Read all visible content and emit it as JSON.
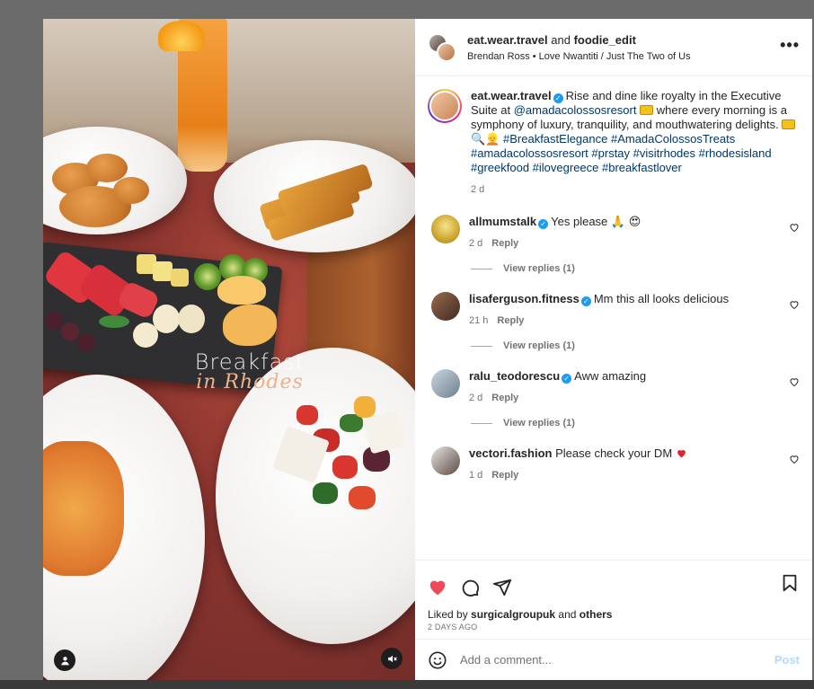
{
  "media": {
    "caption_title": "Breakfast",
    "caption_sub": "in Rhodes"
  },
  "header": {
    "user1": "eat.wear.travel",
    "and_word": "and",
    "user2": "foodie_edit",
    "audio": "Brendan Ross • Love Nwantiti / Just The Two of Us",
    "more": "•••"
  },
  "caption": {
    "username": "eat.wear.travel",
    "text_1": "Rise and dine like royalty in the Executive Suite at",
    "mention": "@amadacolossosresort",
    "text_2": "where every morning is a symphony of luxury, tranquility, and mouthwatering delights.",
    "hashtags_1": "#BreakfastElegance #AmadaColossosTreats",
    "hashtags_2": "#amadacolossosresort #prstay #visitrhodes #rhodesisland",
    "hashtags_3": "#greekfood #ilovegreece #breakfastlover",
    "time": "2 d"
  },
  "comments": [
    {
      "username": "allmumstalk",
      "text": "Yes please",
      "time": "2 d",
      "reply": "Reply",
      "view_replies": "View replies (1)",
      "verified": true
    },
    {
      "username": "lisaferguson.fitness",
      "text": "Mm this all looks delicious",
      "time": "21 h",
      "reply": "Reply",
      "view_replies": "View replies (1)",
      "verified": true
    },
    {
      "username": "ralu_teodorescu",
      "text": "Aww amazing",
      "time": "2 d",
      "reply": "Reply",
      "view_replies": "View replies (1)",
      "verified": true
    },
    {
      "username": "vectori.fashion",
      "text": "Please check your DM",
      "time": "1 d",
      "reply": "Reply",
      "verified": false
    }
  ],
  "likes": {
    "prefix": "Liked by",
    "user": "surgicalgroupuk",
    "and_word": "and",
    "others": "others",
    "time_ago": "2 DAYS AGO"
  },
  "add_comment": {
    "placeholder": "Add a comment...",
    "post": "Post"
  },
  "colors": {
    "like_red": "#ed4956",
    "link_blue": "#00376b",
    "verified_blue": "#1d9bf0",
    "post_disabled": "#b3dbff"
  },
  "icons": [
    "heart-icon",
    "comment-icon",
    "share-icon",
    "bookmark-icon",
    "emoji-icon",
    "user-tag-icon",
    "mute-icon",
    "more-icon"
  ]
}
